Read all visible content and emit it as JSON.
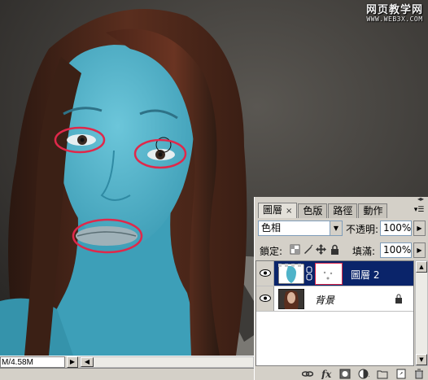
{
  "watermark": {
    "line1": "网页教学网",
    "line2": "WWW.WEB3X.COM"
  },
  "statusbar": {
    "doc_size": "M/4.58M"
  },
  "layers_panel": {
    "tabs": [
      {
        "label": "圖層",
        "close": "×"
      },
      {
        "label": "色版"
      },
      {
        "label": "路徑"
      },
      {
        "label": "動作"
      }
    ],
    "blend_mode": "色相",
    "opacity_label": "不透明:",
    "opacity_value": "100%",
    "lock_label": "鎖定:",
    "fill_label": "填滿:",
    "fill_value": "100%",
    "layers": [
      {
        "name": "圖層 2",
        "selected": true,
        "visible": true,
        "has_mask": true
      },
      {
        "name": "背景",
        "selected": false,
        "visible": true,
        "locked": true
      }
    ],
    "bottom_icons": [
      "link-icon",
      "fx-icon",
      "mask-icon",
      "adjustment-icon",
      "folder-icon",
      "new-layer-icon",
      "trash-icon"
    ]
  },
  "colors": {
    "skin_overlay": "#4fb3c9",
    "selection_ellipse": "#e0284a",
    "selected_layer_bg": "#0a246a",
    "panel_bg": "#d4d0c8"
  }
}
